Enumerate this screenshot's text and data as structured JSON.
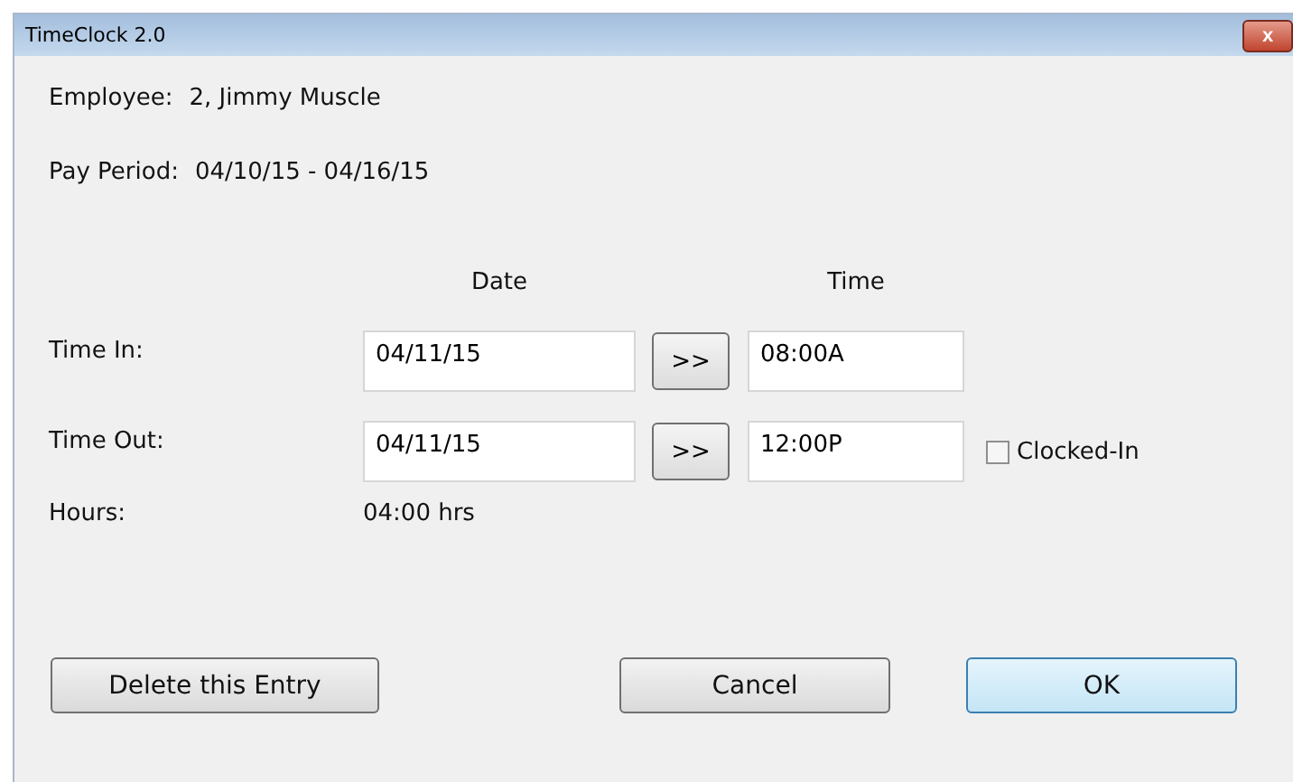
{
  "window": {
    "title": "TimeClock 2.0",
    "close_label": "x"
  },
  "employee": {
    "label": "Employee:",
    "value": "2, Jimmy Muscle"
  },
  "pay_period": {
    "label": "Pay Period:",
    "value": "04/10/15 - 04/16/15"
  },
  "columns": [
    "Date",
    "Time"
  ],
  "rows": [
    {
      "label": "Time In:",
      "date": "04/11/15",
      "copy_button": ">>",
      "time": "08:00A"
    },
    {
      "label": "Time Out:",
      "date": "04/11/15",
      "copy_button": ">>",
      "time": "12:00P",
      "checkbox": {
        "label": "Clocked-In",
        "checked": false
      }
    }
  ],
  "hours": {
    "label": "Hours:",
    "value": "04:00 hrs"
  },
  "buttons": [
    {
      "label": "Delete this Entry",
      "default": false
    },
    {
      "label": "Cancel",
      "default": false
    },
    {
      "label": "OK",
      "default": true
    }
  ]
}
